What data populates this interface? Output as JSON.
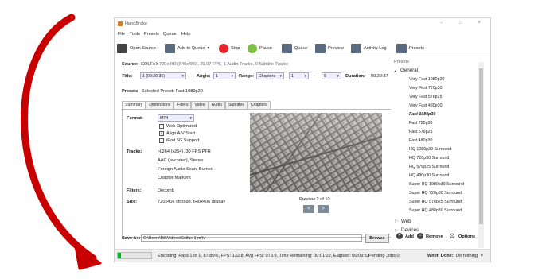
{
  "app": {
    "title": "HandBrake"
  },
  "window_controls": {
    "minimize": "–",
    "maximize": "□",
    "close": "×"
  },
  "menu": [
    "File",
    "Tools",
    "Presets",
    "Queue",
    "Help"
  ],
  "toolbar": {
    "open_source": "Open Source",
    "add_to_queue": "Add to Queue",
    "add_to_queue_arrow": "▾",
    "stop": "Stop",
    "pause": "Pause",
    "queue": "Queue",
    "preview": "Preview",
    "activity_log": "Activity Log",
    "presets": "Presets"
  },
  "source": {
    "label": "Source:",
    "name": "COLFAX",
    "info": "720x480 (640x480), 29.97 FPS, 1 Audio Tracks, 0 Subtitle Tracks"
  },
  "title_row": {
    "title_label": "Title:",
    "title_value": "1 (00:29:36)",
    "angle_label": "Angle:",
    "angle_value": "1",
    "range_label": "Range:",
    "range_type": "Chapters",
    "range_start": "1",
    "range_dash": "-",
    "range_end": "6",
    "duration_label": "Duration:",
    "duration_value": "00:29:37"
  },
  "preset_row": {
    "label": "Presets",
    "value": "Selected Preset: Fast 1080p30"
  },
  "tabs": [
    "Summary",
    "Dimensions",
    "Filters",
    "Video",
    "Audio",
    "Subtitles",
    "Chapters"
  ],
  "summary": {
    "format_label": "Format:",
    "format_value": "MP4",
    "checkboxes": [
      {
        "label": "Web Optimized",
        "checked": false
      },
      {
        "label": "Align A/V Start",
        "checked": true
      },
      {
        "label": "iPod 5G Support",
        "checked": false
      }
    ],
    "check_mark": "✓",
    "tracks_label": "Tracks:",
    "tracks": [
      "H.264 (x264), 30 FPS PFR",
      "AAC (avcodec), Stereo",
      "Foreign Audio Scan, Burned",
      "Chapter Markers"
    ],
    "filters_label": "Filters:",
    "filters_value": "Decomb",
    "size_label": "Size:",
    "size_value": "720x406 storage, 640x406 display",
    "preview_caption": "Preview 2 of 10",
    "prev_btn": "<",
    "next_btn": ">"
  },
  "presets_panel": {
    "title": "Presets",
    "general": "General",
    "general_arrow": "◢",
    "items": [
      "Very Fast 1080p30",
      "Very Fast 720p30",
      "Very Fast 576p25",
      "Very Fast 480p30",
      "Fast 1080p30",
      "Fast 720p30",
      "Fast 576p25",
      "Fast 480p30",
      "HQ 1080p30 Surround",
      "HQ 720p30 Surround",
      "HQ 576p25 Surround",
      "HQ 480p30 Surround",
      "Super HQ 1080p30 Surround",
      "Super HQ 720p30 Surround",
      "Super HQ 576p25 Surround",
      "Super HQ 480p30 Surround"
    ],
    "selected": "Fast 1080p30",
    "web": "Web",
    "devices": "Devices",
    "collapsed_arrow": "▷",
    "add": "Add",
    "remove": "Remove",
    "options": "Options"
  },
  "save": {
    "label": "Save As:",
    "path": "C:\\Users\\Bill\\Videos\\Colfax-1.m4v",
    "browse": "Browse"
  },
  "status": {
    "progress": 0.1,
    "text": "Encoding: Pass 1 of 1,  87.80%, FPS: 132.8,  Avg FPS: 078.9,  Time Remaining: 00:01:22,  Elapsed: 00:09:53",
    "pending": "Pending Jobs 0",
    "when_done_label": "When Done:",
    "when_done_value": "Do nothing",
    "when_done_arrow": "▾"
  },
  "colors": {
    "arrow": "#c80000",
    "progress": "#06b025",
    "stop": "#e8252b",
    "pause": "#7cc242",
    "accent": "#2b5797"
  }
}
